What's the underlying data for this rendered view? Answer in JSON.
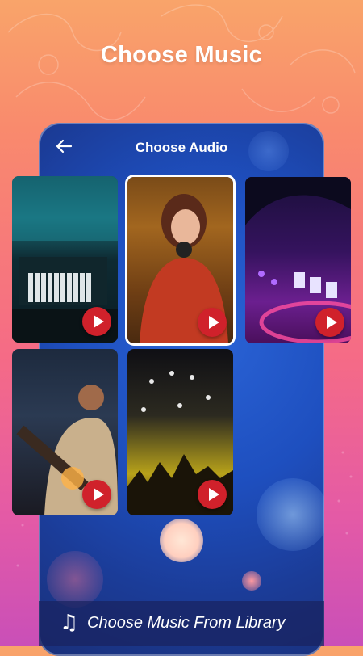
{
  "header": {
    "title": "Choose Music"
  },
  "screen": {
    "title": "Choose Audio",
    "back_icon": "arrow-left-icon"
  },
  "cards": [
    {
      "scene": "studio keyboard",
      "action_icon": "play-icon",
      "selected": false
    },
    {
      "scene": "woman with headphones",
      "action_icon": "play-icon",
      "selected": true
    },
    {
      "scene": "dj mixer neon",
      "action_icon": "play-icon",
      "selected": false
    },
    {
      "scene": "guitarist",
      "action_icon": "play-icon",
      "selected": false
    },
    {
      "scene": "concert crowd",
      "action_icon": "play-icon",
      "selected": false
    }
  ],
  "footer": {
    "icon": "music-note-icon",
    "label": "Choose Music From Library"
  },
  "colors": {
    "accent_play": "#d0212b",
    "panel": "#1e4fbf"
  }
}
